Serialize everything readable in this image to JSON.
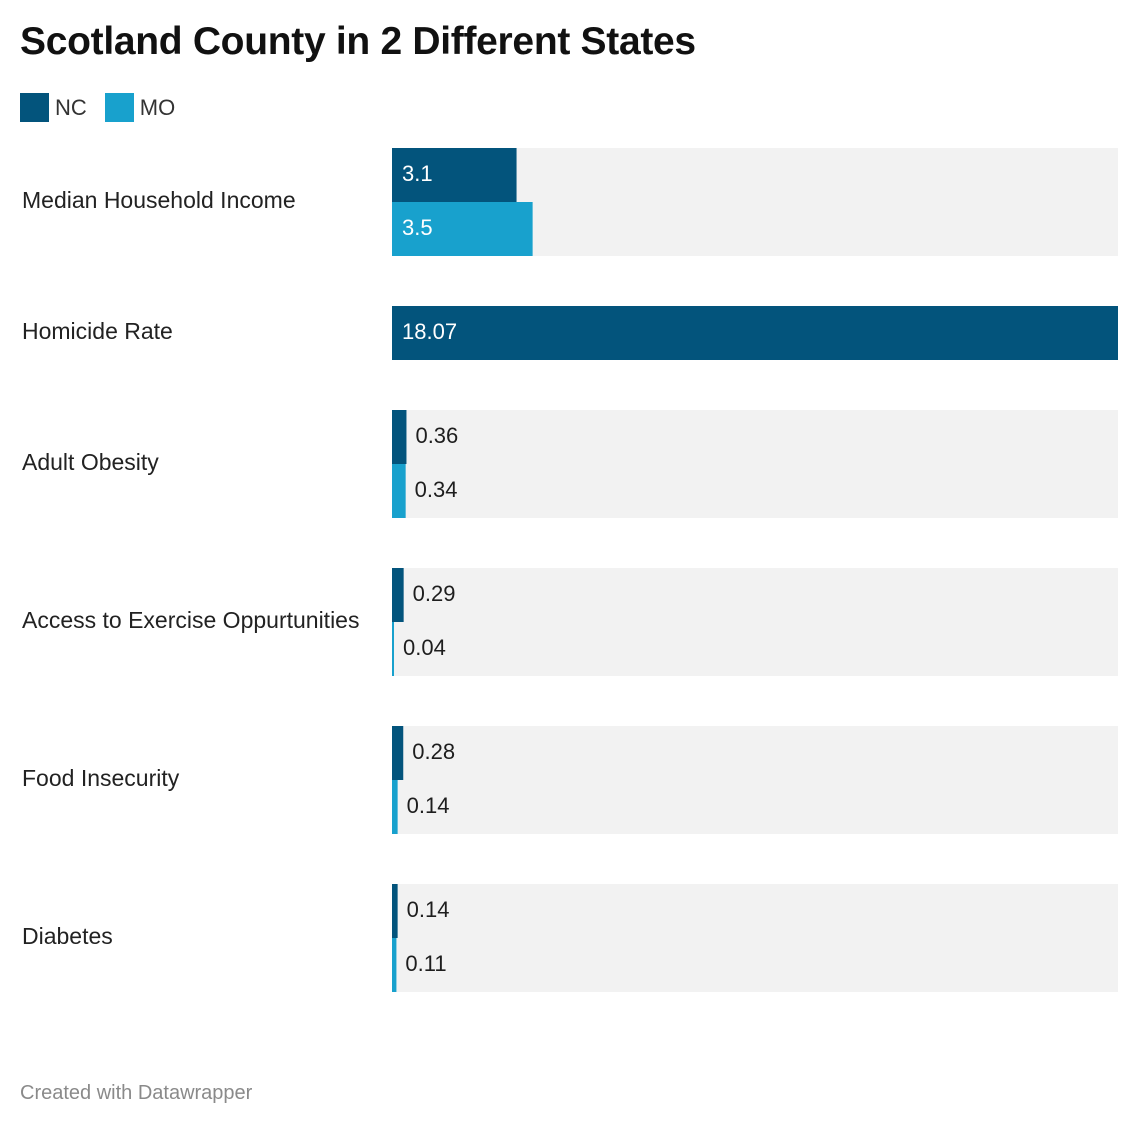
{
  "title": "Scotland County in 2 Different States",
  "footer": "Created with Datawrapper",
  "colors": {
    "NC": "#03547c",
    "MO": "#18a1cd",
    "track": "#f2f2f2",
    "label_on_bar": "#ffffff",
    "label_off_bar": "#1e1e1e"
  },
  "chart_data": {
    "type": "bar",
    "orientation": "horizontal",
    "categories": [
      "Median Household Income",
      "Homicide Rate",
      "Adult Obesity",
      "Access to Exercise Oppurtunities",
      "Food Insecurity",
      "Diabetes"
    ],
    "series": [
      {
        "name": "NC",
        "values": [
          3.1,
          18.07,
          0.36,
          0.29,
          0.28,
          0.14
        ]
      },
      {
        "name": "MO",
        "values": [
          3.5,
          null,
          0.34,
          0.04,
          0.14,
          0.11
        ]
      }
    ],
    "value_labels": [
      [
        "3.1",
        "3.5"
      ],
      [
        "18.07",
        null
      ],
      [
        "0.36",
        "0.34"
      ],
      [
        "0.29",
        "0.04"
      ],
      [
        "0.28",
        "0.14"
      ],
      [
        "0.14",
        "0.11"
      ]
    ],
    "xlim": [
      0,
      18.07
    ],
    "grid": false,
    "legend_position": "top-left"
  }
}
